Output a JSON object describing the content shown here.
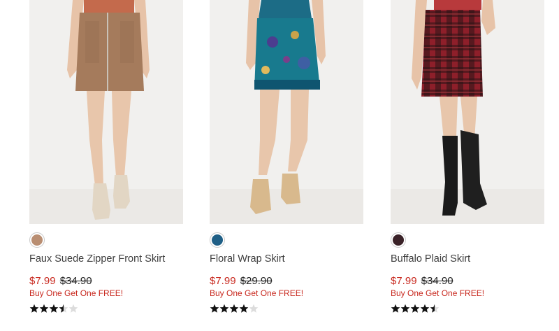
{
  "products": [
    {
      "name": "Faux Suede Zipper Front Skirt",
      "sale_price": "$7.99",
      "original_price": "$34.90",
      "promo": "Buy One Get One FREE!",
      "rating": 3.5,
      "swatch_color": "#b98e72"
    },
    {
      "name": "Floral Wrap Skirt",
      "sale_price": "$7.99",
      "original_price": "$29.90",
      "promo": "Buy One Get One FREE!",
      "rating": 4,
      "swatch_color": "#1f5f86"
    },
    {
      "name": "Buffalo Plaid Skirt",
      "sale_price": "$7.99",
      "original_price": "$34.90",
      "promo": "Buy One Get One FREE!",
      "rating": 4.5,
      "swatch_color": "#3a2228"
    }
  ],
  "colors": {
    "sale": "#c8281e",
    "star_filled": "#111111",
    "star_empty": "#dcdcdc"
  },
  "icons": [
    "star-icon"
  ]
}
